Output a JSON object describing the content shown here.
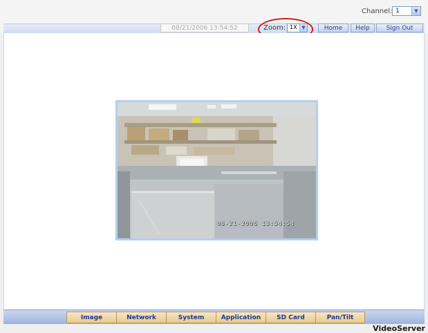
{
  "header": {
    "channel_label": "Channel:",
    "channel_value": "1",
    "datetime": "08/21/2006 13:54:52",
    "zoom_label": "Zoom:",
    "zoom_value": "1X",
    "nav": {
      "home": "Home",
      "help": "Help",
      "sign_out": "Sign Out"
    }
  },
  "video": {
    "overlay_timestamp": "08-21-2006 13:54:54"
  },
  "tabs": [
    {
      "label": "Image"
    },
    {
      "label": "Network"
    },
    {
      "label": "System"
    },
    {
      "label": "Application"
    },
    {
      "label": "SD Card"
    },
    {
      "label": "Pan/Tilt"
    }
  ],
  "footer": {
    "brand": "VideoServer"
  },
  "colors": {
    "tab_bg": "#e7c98e",
    "tab_text": "#1d3a8a",
    "highlight_circle": "#d11a1a",
    "bar_blue": "#9fb3dc"
  }
}
